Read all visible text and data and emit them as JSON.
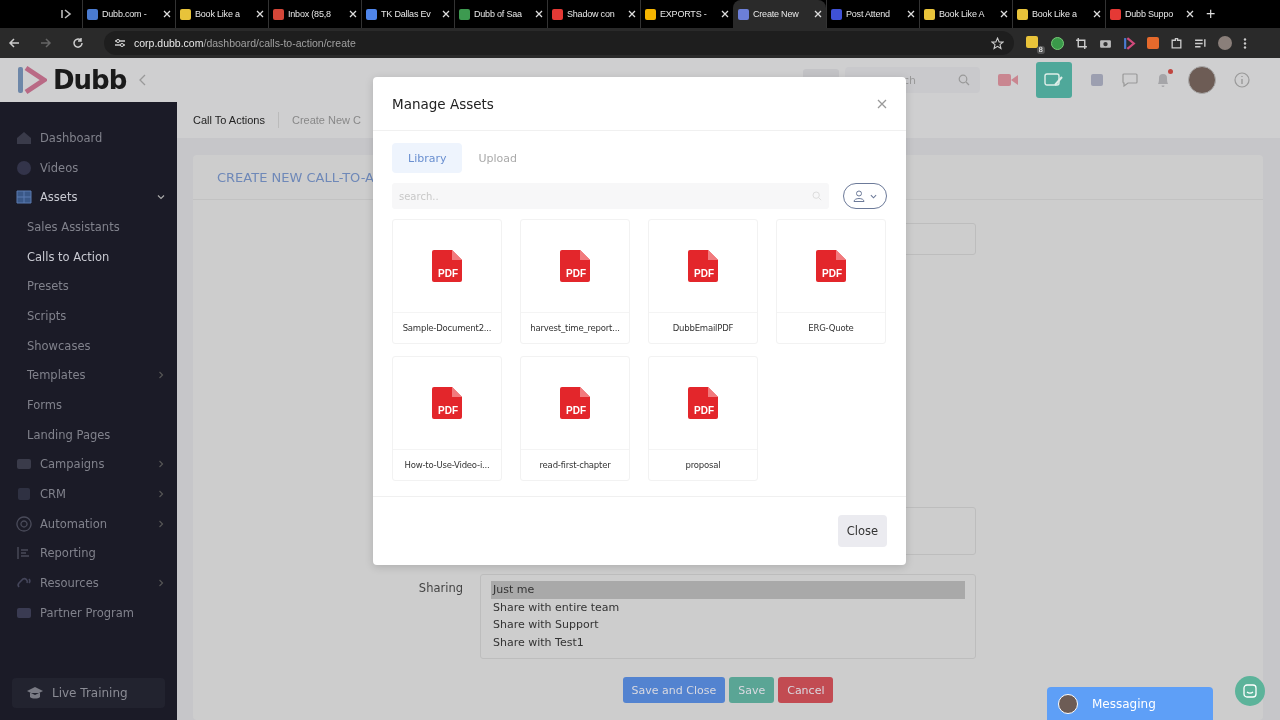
{
  "browser": {
    "tabs": [
      {
        "title": "Dubb.com -",
        "color": "#4a7bd0",
        "selected": false
      },
      {
        "title": "Book Like a",
        "color": "#e8c33a",
        "selected": false
      },
      {
        "title": "Inbox (85,8",
        "color": "#d44638",
        "selected": false
      },
      {
        "title": "TK Dallas Ev",
        "color": "#4f86ec",
        "selected": false
      },
      {
        "title": "Dubb of Saa",
        "color": "#3d9a50",
        "selected": false
      },
      {
        "title": "Shadow con",
        "color": "#e53935",
        "selected": false
      },
      {
        "title": "EXPORTS -",
        "color": "#f4b400",
        "selected": false
      },
      {
        "title": "Create New",
        "color": "#6c7fd8",
        "selected": true
      },
      {
        "title": "Post Attend",
        "color": "#3f51d6",
        "selected": false
      },
      {
        "title": "Book Like A",
        "color": "#e8c33a",
        "selected": false
      },
      {
        "title": "Book Like a",
        "color": "#e8c33a",
        "selected": false
      },
      {
        "title": "Dubb Suppo",
        "color": "#e53935",
        "selected": false
      }
    ],
    "new_tab": "+",
    "url_host": "corp.dubb.com",
    "url_path": "/dashboard/calls-to-action/create",
    "extension_badge": "8"
  },
  "header": {
    "logo": "Dubb",
    "search_placeholder": "ch",
    "notification_dot": true
  },
  "sidebar": {
    "items": [
      {
        "label": "Dashboard",
        "kind": "main",
        "selected": false
      },
      {
        "label": "Videos",
        "kind": "main",
        "selected": false
      },
      {
        "label": "Assets",
        "kind": "main",
        "selected": true,
        "expanded": true
      },
      {
        "label": "Sales Assistants",
        "kind": "sub",
        "selected": false
      },
      {
        "label": "Calls to Action",
        "kind": "sub",
        "selected": true
      },
      {
        "label": "Presets",
        "kind": "sub",
        "selected": false
      },
      {
        "label": "Scripts",
        "kind": "sub",
        "selected": false
      },
      {
        "label": "Showcases",
        "kind": "sub",
        "selected": false
      },
      {
        "label": "Templates",
        "kind": "sub",
        "selected": false,
        "expanded": false
      },
      {
        "label": "Forms",
        "kind": "sub",
        "selected": false
      },
      {
        "label": "Landing Pages",
        "kind": "sub",
        "selected": false
      },
      {
        "label": "Campaigns",
        "kind": "main",
        "selected": false,
        "expanded": false
      },
      {
        "label": "CRM",
        "kind": "main",
        "selected": false,
        "expanded": false
      },
      {
        "label": "Automation",
        "kind": "main",
        "selected": false,
        "expanded": false
      },
      {
        "label": "Reporting",
        "kind": "main",
        "selected": false
      },
      {
        "label": "Resources",
        "kind": "main",
        "selected": false,
        "expanded": false
      },
      {
        "label": "Partner Program",
        "kind": "main",
        "selected": false
      }
    ],
    "live_training": "Live Training"
  },
  "breadcrumbs": [
    "Call To Actions",
    "Create New C"
  ],
  "card": {
    "title": "CREATE NEW CALL-TO-A",
    "sharing": {
      "label": "Sharing",
      "options": [
        {
          "label": "Just me",
          "selected": true
        },
        {
          "label": "Share with entire team",
          "selected": false
        },
        {
          "label": "Share with Support",
          "selected": false
        },
        {
          "label": "Share with Test1",
          "selected": false
        }
      ]
    },
    "buttons": [
      {
        "label": "Save and Close",
        "kind": "primary"
      },
      {
        "label": "Save",
        "kind": "success"
      },
      {
        "label": "Cancel",
        "kind": "danger"
      }
    ]
  },
  "modal": {
    "title": "Manage Assets",
    "tabs": [
      {
        "label": "Library",
        "selected": true
      },
      {
        "label": "Upload",
        "selected": false
      }
    ],
    "search_placeholder": "search..",
    "assets": [
      {
        "name": "Sample-Document2...",
        "badge": "PDF"
      },
      {
        "name": "harvest_time_report...",
        "badge": "PDF"
      },
      {
        "name": "DubbEmailPDF",
        "badge": "PDF"
      },
      {
        "name": "ERG-Quote",
        "badge": "PDF"
      },
      {
        "name": "How-to-Use-Video-i...",
        "badge": "PDF"
      },
      {
        "name": "read-first-chapter",
        "badge": "PDF"
      },
      {
        "name": "proposal",
        "badge": "PDF"
      }
    ],
    "close_button": "Close"
  },
  "messaging": {
    "label": "Messaging"
  }
}
